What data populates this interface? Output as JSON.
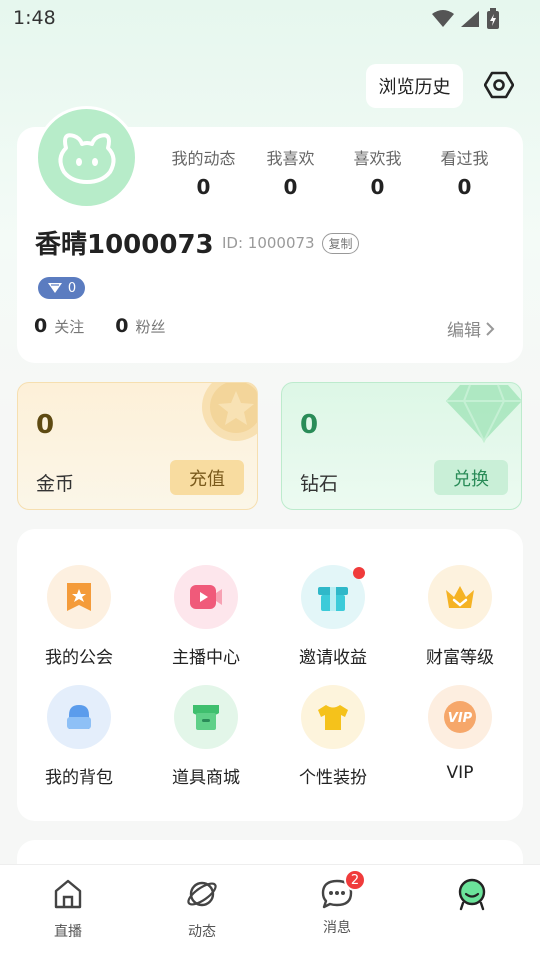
{
  "status_bar": {
    "time": "1:48"
  },
  "top": {
    "history_label": "浏览历史"
  },
  "profile": {
    "stats": [
      {
        "label": "我的动态",
        "value": "0"
      },
      {
        "label": "我喜欢",
        "value": "0"
      },
      {
        "label": "喜欢我",
        "value": "0"
      },
      {
        "label": "看过我",
        "value": "0"
      }
    ],
    "username": "香晴1000073",
    "user_id": "ID: 1000073",
    "copy_label": "复制",
    "level": "0",
    "following_count": "0",
    "following_label": "关注",
    "fans_count": "0",
    "fans_label": "粉丝",
    "edit_label": "编辑"
  },
  "wallet": {
    "coins": {
      "value": "0",
      "label": "金币",
      "button": "充值"
    },
    "diamonds": {
      "value": "0",
      "label": "钻石",
      "button": "兑换"
    }
  },
  "menu": [
    {
      "label": "我的公会",
      "icon": "guild-icon"
    },
    {
      "label": "主播中心",
      "icon": "anchor-center-icon"
    },
    {
      "label": "邀请收益",
      "icon": "invite-gift-icon"
    },
    {
      "label": "财富等级",
      "icon": "crown-icon"
    },
    {
      "label": "我的背包",
      "icon": "backpack-icon"
    },
    {
      "label": "道具商城",
      "icon": "shop-icon"
    },
    {
      "label": "个性装扮",
      "icon": "outfit-icon"
    },
    {
      "label": "VIP",
      "icon": "vip-icon"
    }
  ],
  "nav": [
    {
      "label": "直播",
      "icon": "home-icon"
    },
    {
      "label": "动态",
      "icon": "planet-icon"
    },
    {
      "label": "消息",
      "icon": "chat-icon",
      "badge": "2"
    },
    {
      "label": "",
      "icon": "profile-icon"
    }
  ],
  "colors": {
    "accent_green": "#2a8c58",
    "coin_gold": "#f8dca0",
    "badge_red": "#f03b3b"
  }
}
